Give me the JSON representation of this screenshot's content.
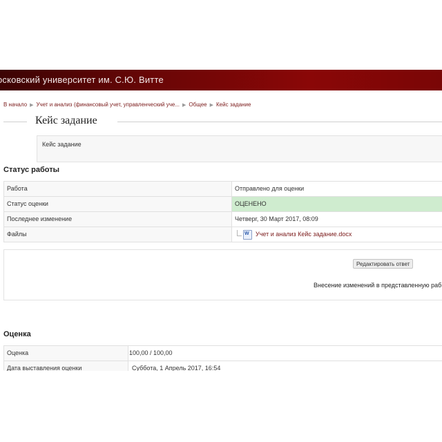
{
  "header": {
    "site_title": "осковский университет им. С.Ю. Витте"
  },
  "breadcrumb": {
    "items": [
      "В начало",
      "Учет и анализ (финансовый учет, управленческий уче...",
      "Общее",
      "Кейс задание"
    ],
    "separator": "▶"
  },
  "page": {
    "title": "Кейс задание",
    "intro": "Кейс задание"
  },
  "status_section": {
    "heading": "Статус работы",
    "rows": [
      {
        "label": "Работа",
        "value": "Отправлено для оценки"
      },
      {
        "label": "Статус оценки",
        "value": "ОЦЕНЕНО"
      },
      {
        "label": "Последнее изменение",
        "value": "Четверг, 30 Март 2017, 08:09"
      },
      {
        "label": "Файлы",
        "value": "Учет и анализ Кейс задание.docx"
      }
    ],
    "file_icon_letter": "W"
  },
  "submission": {
    "edit_button": "Редактировать ответ",
    "note": "Внесение изменений в представленную раб"
  },
  "grade_section": {
    "heading": "Оценка",
    "rows": [
      {
        "label": "Оценка",
        "value": "100,00 / 100,00"
      },
      {
        "label": "Дата выставления оценки",
        "value": "Суббота, 1 Апрель 2017, 16:54"
      }
    ]
  },
  "colors": {
    "header_bg": "#6a0606",
    "link": "#7b1b1b",
    "graded_bg": "#cfeccf"
  }
}
